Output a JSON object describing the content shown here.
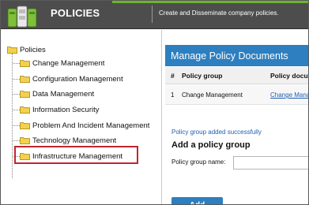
{
  "header": {
    "app_title": "POLICIES",
    "tagline": "Create and Disseminate company policies.",
    "logo_icon": "filing-cabinet-icon",
    "accent_color": "#6fb22f",
    "bar_color": "#4d4d4d"
  },
  "tree": {
    "root_label": "Policies",
    "folder_icon": "folder-icon",
    "items": [
      {
        "label": "Change Management"
      },
      {
        "label": "Configuration Management"
      },
      {
        "label": "Data Management"
      },
      {
        "label": "Information Security"
      },
      {
        "label": "Problem And Incident Management"
      },
      {
        "label": "Technology Management"
      },
      {
        "label": "Infrastructure Management"
      }
    ],
    "highlight_color": "#c0262e"
  },
  "panel": {
    "title": "Manage Policy Documents",
    "title_bar_color": "#2d7fbf",
    "columns": [
      "#",
      "Policy group",
      "Policy docu"
    ],
    "rows": [
      {
        "num": "1",
        "group": "Change Management",
        "doc": "Change Mana"
      }
    ],
    "success_message": "Policy group added successfully",
    "add_section_title": "Add a policy group",
    "field_label": "Policy group name:",
    "field_value": "",
    "button_label": "Add"
  }
}
